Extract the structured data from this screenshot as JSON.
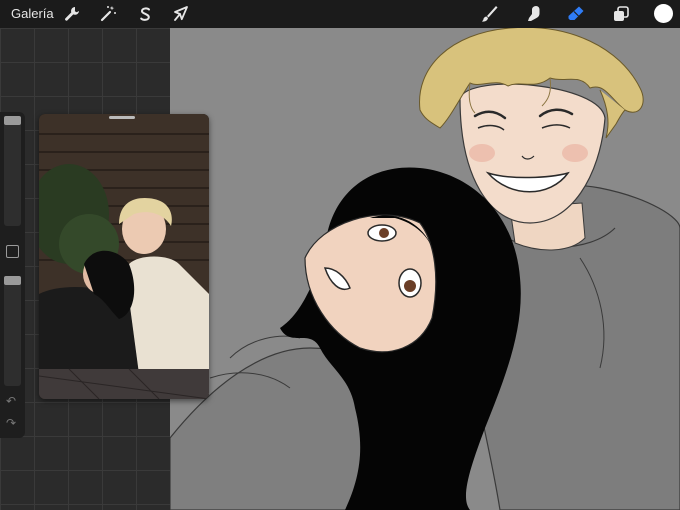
{
  "toolbar": {
    "gallery_label": "Galería",
    "left_tools": [
      {
        "icon": "wrench-icon",
        "name": "actions"
      },
      {
        "icon": "magic-wand-icon",
        "name": "adjustments"
      },
      {
        "icon": "selection-s-icon",
        "name": "selection"
      },
      {
        "icon": "cursor-arrow-icon",
        "name": "transform"
      }
    ],
    "right_tools": [
      {
        "icon": "brush-icon",
        "name": "brush"
      },
      {
        "icon": "smudge-icon",
        "name": "smudge"
      },
      {
        "icon": "eraser-icon",
        "name": "eraser",
        "active": true
      },
      {
        "icon": "layers-icon",
        "name": "layers"
      }
    ],
    "current_color": "#ffffff",
    "active_color": "#2f7cf6"
  },
  "sidebar": {
    "brush_size_level": 0.0,
    "opacity_level": 0.0
  },
  "colors": {
    "canvas_bg": "#8a8a8a",
    "hoodie": "#7d7d7d",
    "hair_dark": "#050505",
    "hair_blond": "#d8c27c",
    "skin": "#f1d3bf"
  }
}
